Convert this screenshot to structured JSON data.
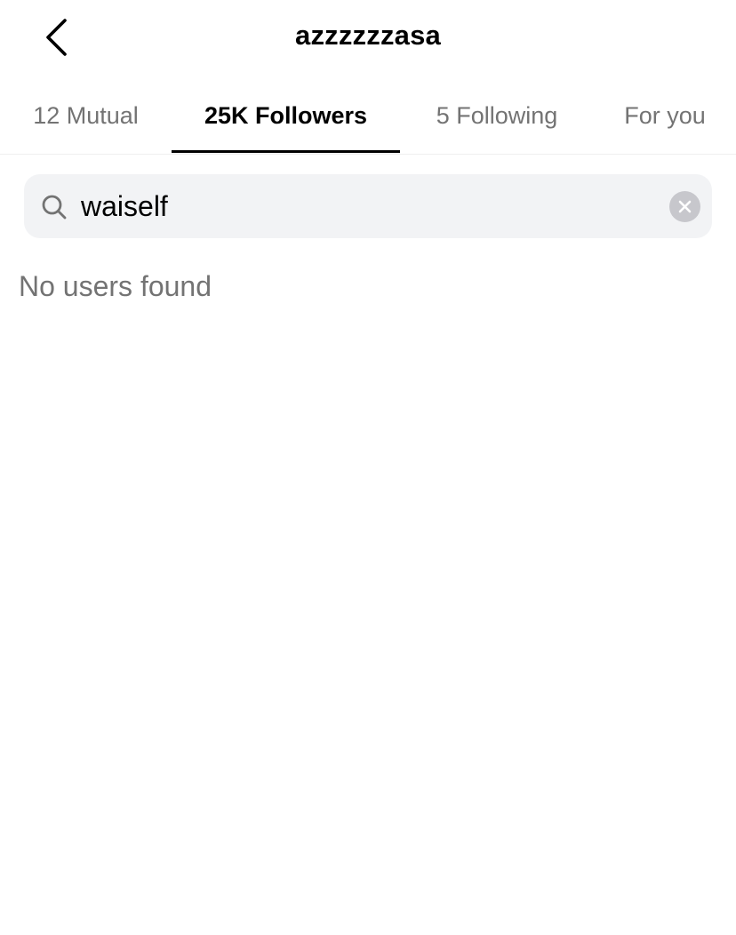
{
  "header": {
    "back_icon": "chevron-left-icon",
    "title": "azzzzzzasa"
  },
  "tabs": [
    {
      "label": "12 Mutual",
      "active": false
    },
    {
      "label": "25K Followers",
      "active": true
    },
    {
      "label": "5 Following",
      "active": false
    },
    {
      "label": "For you",
      "active": false
    }
  ],
  "search": {
    "icon": "search-icon",
    "value": "waiself",
    "clear_icon": "clear-icon"
  },
  "results": {
    "empty_message": "No users found"
  },
  "colors": {
    "text_primary": "#000000",
    "text_secondary": "#737373",
    "search_background": "#f2f3f5",
    "clear_button": "#c7c7cc",
    "divider": "#efefef"
  }
}
